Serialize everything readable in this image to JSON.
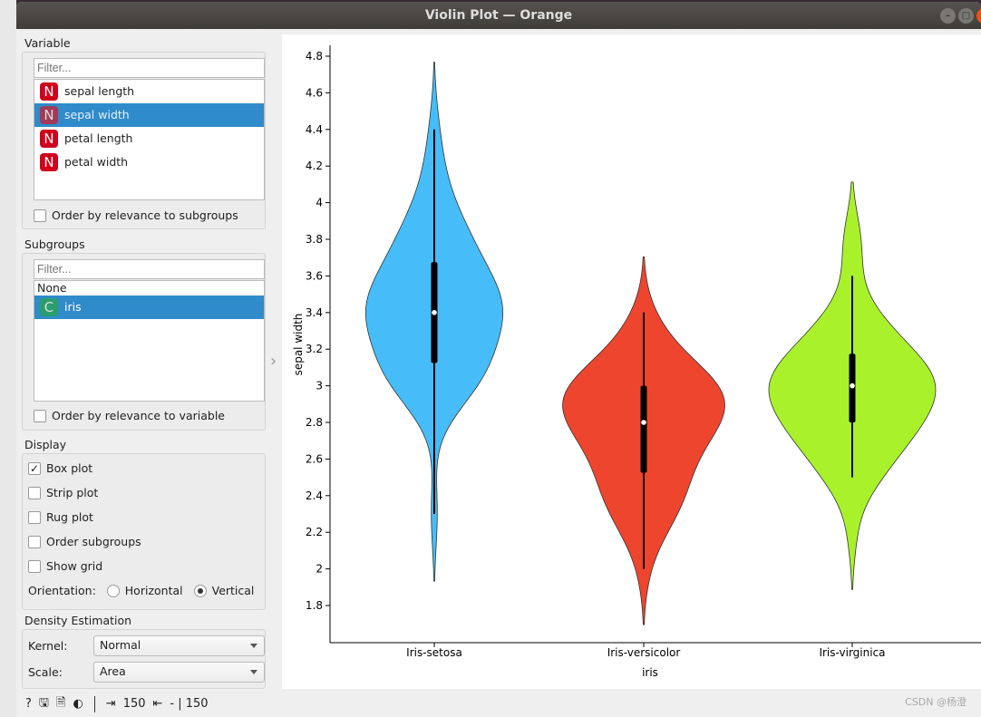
{
  "window": {
    "title": "Violin Plot — Orange",
    "minimize": "–",
    "maximize": "□",
    "close": "×"
  },
  "variable": {
    "label": "Variable",
    "filter_placeholder": "Filter...",
    "items": [
      {
        "label": "sepal length",
        "type": "N"
      },
      {
        "label": "sepal width",
        "type": "N",
        "selected": true
      },
      {
        "label": "petal length",
        "type": "N"
      },
      {
        "label": "petal width",
        "type": "N"
      }
    ],
    "order_label": "Order by relevance to subgroups",
    "order_checked": false
  },
  "subgroups": {
    "label": "Subgroups",
    "filter_placeholder": "Filter...",
    "none_label": "None",
    "items": [
      {
        "label": "iris",
        "type": "C",
        "selected": true
      }
    ],
    "order_label": "Order by relevance to variable",
    "order_checked": false
  },
  "display": {
    "label": "Display",
    "options": [
      {
        "label": "Box plot",
        "checked": true
      },
      {
        "label": "Strip plot",
        "checked": false
      },
      {
        "label": "Rug plot",
        "checked": false
      },
      {
        "label": "Order subgroups",
        "checked": false
      },
      {
        "label": "Show grid",
        "checked": false
      }
    ],
    "orientation_label": "Orientation:",
    "horizontal": "Horizontal",
    "vertical": "Vertical",
    "orientation": "Vertical"
  },
  "density": {
    "label": "Density Estimation",
    "kernel_label": "Kernel:",
    "kernel": "Normal",
    "scale_label": "Scale:",
    "scale": "Area"
  },
  "status": {
    "input_count": "150",
    "output_count": "- | 150"
  },
  "watermark": "CSDN @杨澄",
  "chart_data": {
    "type": "violin",
    "xlabel": "iris",
    "ylabel": "sepal width",
    "ylim": [
      1.7,
      4.85
    ],
    "yticks": [
      "1.8",
      "2",
      "2.2",
      "2.4",
      "2.6",
      "2.8",
      "3",
      "3.2",
      "3.4",
      "3.6",
      "3.8",
      "4",
      "4.2",
      "4.4",
      "4.6",
      "4.8"
    ],
    "grid": false,
    "groups": [
      {
        "name": "Iris-setosa",
        "color": "#46bdf8",
        "box": {
          "min": 2.3,
          "q1": 3.125,
          "median": 3.4,
          "q3": 3.675,
          "max": 4.4
        },
        "values": [
          3.5,
          3.0,
          3.2,
          3.1,
          3.6,
          3.9,
          3.4,
          3.4,
          2.9,
          3.1,
          3.7,
          3.4,
          3.0,
          3.0,
          4.0,
          4.4,
          3.9,
          3.5,
          3.8,
          3.8,
          3.4,
          3.7,
          3.6,
          3.3,
          3.4,
          3.0,
          3.4,
          3.5,
          3.4,
          3.2,
          3.1,
          3.4,
          4.1,
          4.2,
          3.1,
          3.2,
          3.5,
          3.6,
          3.0,
          3.4,
          3.5,
          2.3,
          3.2,
          3.5,
          3.8,
          3.0,
          3.8,
          3.2,
          3.7,
          3.3
        ]
      },
      {
        "name": "Iris-versicolor",
        "color": "#ee452f",
        "box": {
          "min": 2.0,
          "q1": 2.525,
          "median": 2.8,
          "q3": 3.0,
          "max": 3.4
        },
        "values": [
          3.2,
          3.2,
          3.1,
          2.3,
          2.8,
          2.8,
          3.3,
          2.4,
          2.9,
          2.7,
          2.0,
          3.0,
          2.2,
          2.9,
          2.9,
          3.1,
          3.0,
          2.7,
          2.2,
          2.5,
          3.2,
          2.8,
          2.5,
          2.8,
          2.9,
          3.0,
          2.8,
          3.0,
          2.9,
          2.6,
          2.4,
          2.4,
          2.7,
          2.7,
          3.0,
          3.4,
          3.1,
          2.3,
          3.0,
          2.5,
          2.6,
          3.0,
          2.6,
          2.3,
          2.7,
          3.0,
          2.9,
          2.9,
          2.5,
          2.8
        ]
      },
      {
        "name": "Iris-virginica",
        "color": "#a9f22b",
        "box": {
          "min": 2.5,
          "q1": 2.8,
          "median": 3.0,
          "q3": 3.175,
          "max": 3.6
        },
        "values": [
          3.3,
          2.7,
          3.0,
          2.9,
          3.0,
          3.0,
          2.5,
          2.9,
          2.5,
          3.6,
          3.2,
          2.7,
          3.0,
          2.5,
          2.8,
          3.2,
          3.0,
          3.8,
          2.6,
          2.2,
          3.2,
          2.8,
          2.8,
          2.7,
          3.3,
          3.2,
          2.8,
          3.0,
          2.8,
          3.0,
          2.8,
          3.8,
          2.8,
          2.8,
          2.6,
          3.0,
          3.4,
          3.1,
          3.0,
          3.1,
          3.1,
          3.1,
          2.7,
          3.2,
          3.3,
          3.0,
          2.5,
          3.0,
          3.4,
          3.0
        ]
      }
    ]
  }
}
